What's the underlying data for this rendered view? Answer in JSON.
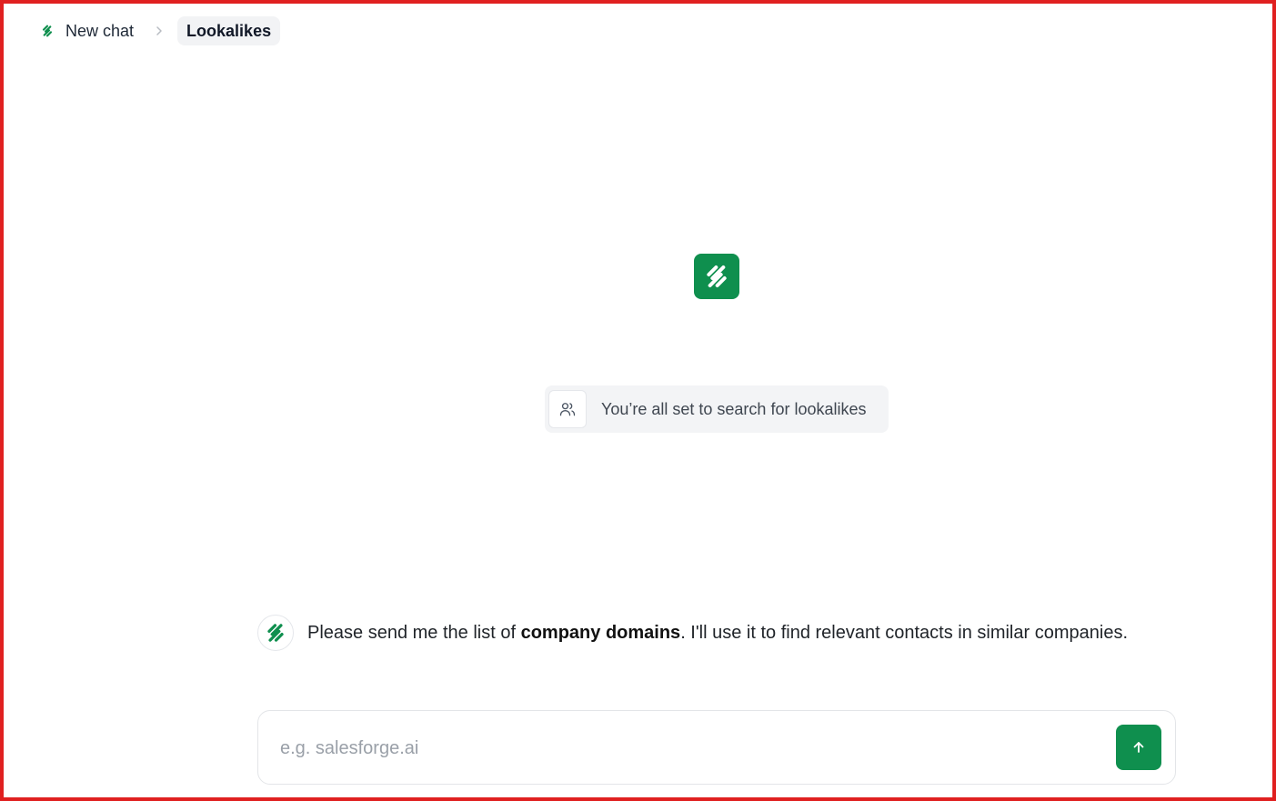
{
  "breadcrumb": {
    "items": [
      {
        "label": "New chat",
        "icon": "salesforge-logo-icon"
      },
      {
        "label": "Lookalikes"
      }
    ],
    "separator_icon": "chevron-right-icon"
  },
  "center": {
    "logo_icon": "salesforge-logo-icon"
  },
  "status": {
    "icon": "users-icon",
    "text": "You’re all set to search for lookalikes"
  },
  "message": {
    "avatar_icon": "salesforge-logo-icon",
    "text_before": "Please send me the list of ",
    "text_bold": "company domains",
    "text_after": ". I'll use it to find relevant contacts in similar companies."
  },
  "composer": {
    "placeholder": "e.g. salesforge.ai",
    "value": "",
    "send_icon": "arrow-up-icon"
  },
  "colors": {
    "brand_green": "#0f8f4e",
    "frame_border": "#e02020",
    "pill_bg": "#f3f4f6"
  }
}
